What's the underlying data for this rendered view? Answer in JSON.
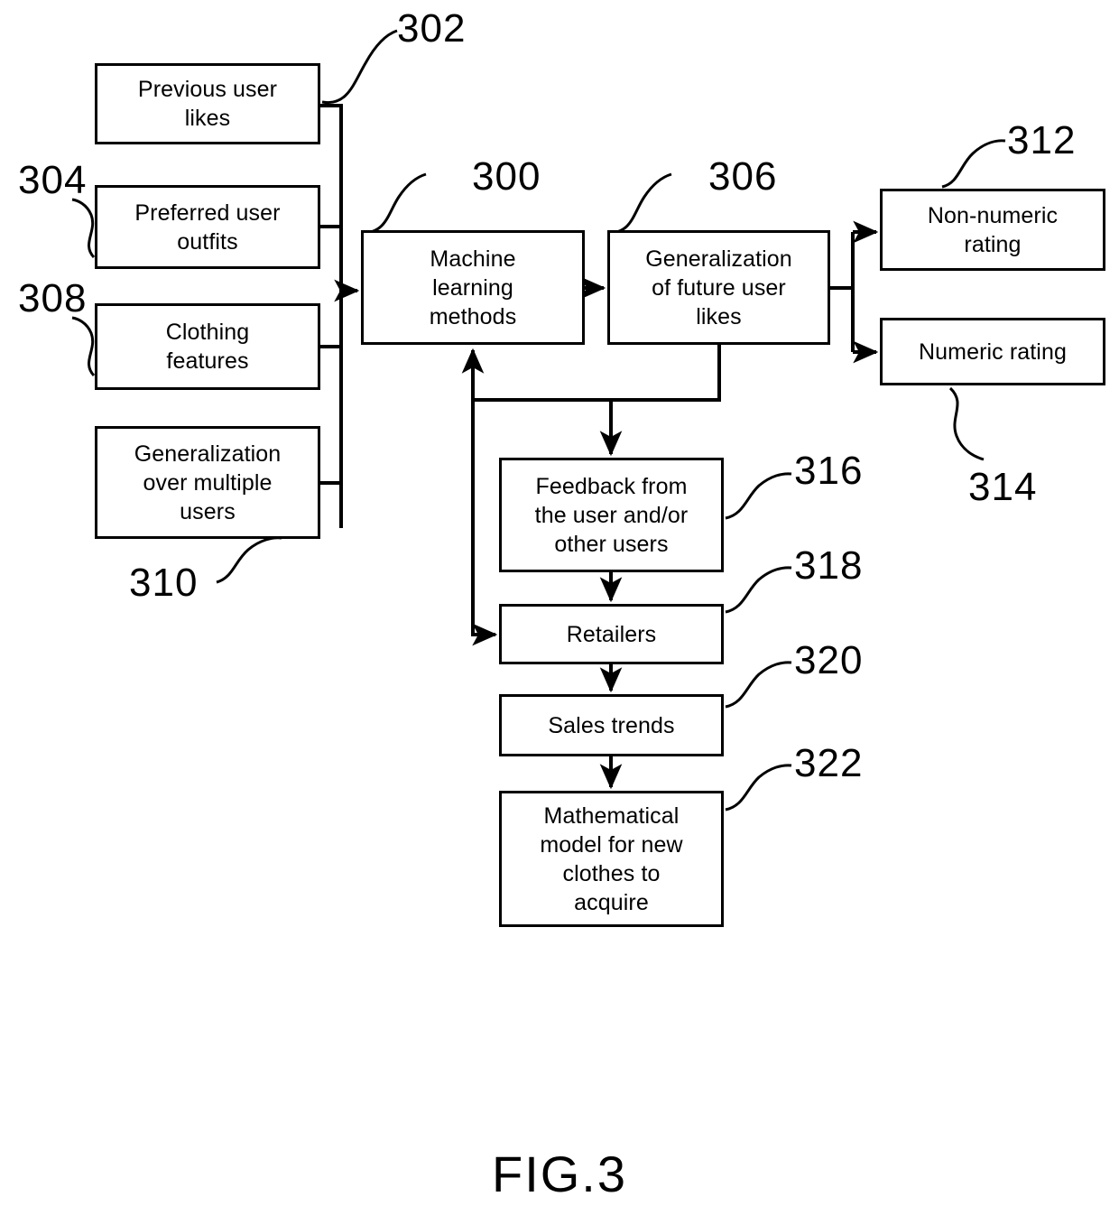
{
  "figure": {
    "caption": "FIG.3",
    "boxes": [
      {
        "id": "previous-user-likes",
        "label": "Previous user\nlikes"
      },
      {
        "id": "preferred-user-outfits",
        "label": "Preferred user\noutfits"
      },
      {
        "id": "clothing-features",
        "label": "Clothing\nfeatures"
      },
      {
        "id": "generalization-over-multiple-users",
        "label": "Generalization\nover multiple\nusers"
      },
      {
        "id": "machine-learning-methods",
        "label": "Machine\nlearning\nmethods"
      },
      {
        "id": "generalization-of-future-user-likes",
        "label": "Generalization\nof future user\nlikes"
      },
      {
        "id": "non-numeric-rating",
        "label": "Non-numeric\nrating"
      },
      {
        "id": "numeric-rating",
        "label": "Numeric rating"
      },
      {
        "id": "feedback-from-users",
        "label": "Feedback from\nthe user and/or\nother users"
      },
      {
        "id": "retailers",
        "label": "Retailers"
      },
      {
        "id": "sales-trends",
        "label": "Sales trends"
      },
      {
        "id": "mathematical-model",
        "label": "Mathematical\nmodel for new\nclothes to\nacquire"
      }
    ],
    "reference_numerals": [
      {
        "id": "ref-302",
        "value": "302",
        "target": "previous-user-likes"
      },
      {
        "id": "ref-304",
        "value": "304",
        "target": "preferred-user-outfits"
      },
      {
        "id": "ref-308",
        "value": "308",
        "target": "clothing-features"
      },
      {
        "id": "ref-310",
        "value": "310",
        "target": "generalization-over-multiple-users"
      },
      {
        "id": "ref-300",
        "value": "300",
        "target": "machine-learning-methods"
      },
      {
        "id": "ref-306",
        "value": "306",
        "target": "generalization-of-future-user-likes"
      },
      {
        "id": "ref-312",
        "value": "312",
        "target": "non-numeric-rating"
      },
      {
        "id": "ref-314",
        "value": "314",
        "target": "numeric-rating"
      },
      {
        "id": "ref-316",
        "value": "316",
        "target": "feedback-from-users"
      },
      {
        "id": "ref-318",
        "value": "318",
        "target": "retailers"
      },
      {
        "id": "ref-320",
        "value": "320",
        "target": "sales-trends"
      },
      {
        "id": "ref-322",
        "value": "322",
        "target": "mathematical-model"
      }
    ]
  }
}
